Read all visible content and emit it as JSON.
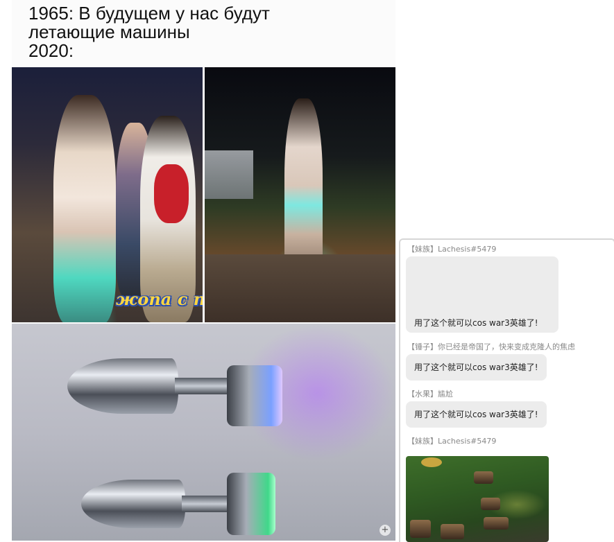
{
  "meme": {
    "caption": "1965: В будущем у нас будут\nлетающие машины\n2020:",
    "overlay_text": "жопа с подсветкой"
  },
  "chat": {
    "messages": [
      {
        "author": "【妹族】Lachesis#5479",
        "text": "用了这个就可以cos war3英雄了!"
      },
      {
        "author": "【锤子】你已经是帝国了，快来变成克隆人的焦虑",
        "text": "用了这个就可以cos war3英雄了!"
      },
      {
        "author": "【水果】尴尬",
        "text": "用了这个就可以cos war3英雄了!"
      },
      {
        "author": "【妹族】Lachesis#5479",
        "image": "warcraft3-screenshot"
      }
    ]
  },
  "colors": {
    "overlay_text": "#ffd640",
    "overlay_outline": "#2a4fb0",
    "bubble": "#ececec",
    "author": "#888888"
  },
  "icons": [
    "zoom-icon"
  ]
}
